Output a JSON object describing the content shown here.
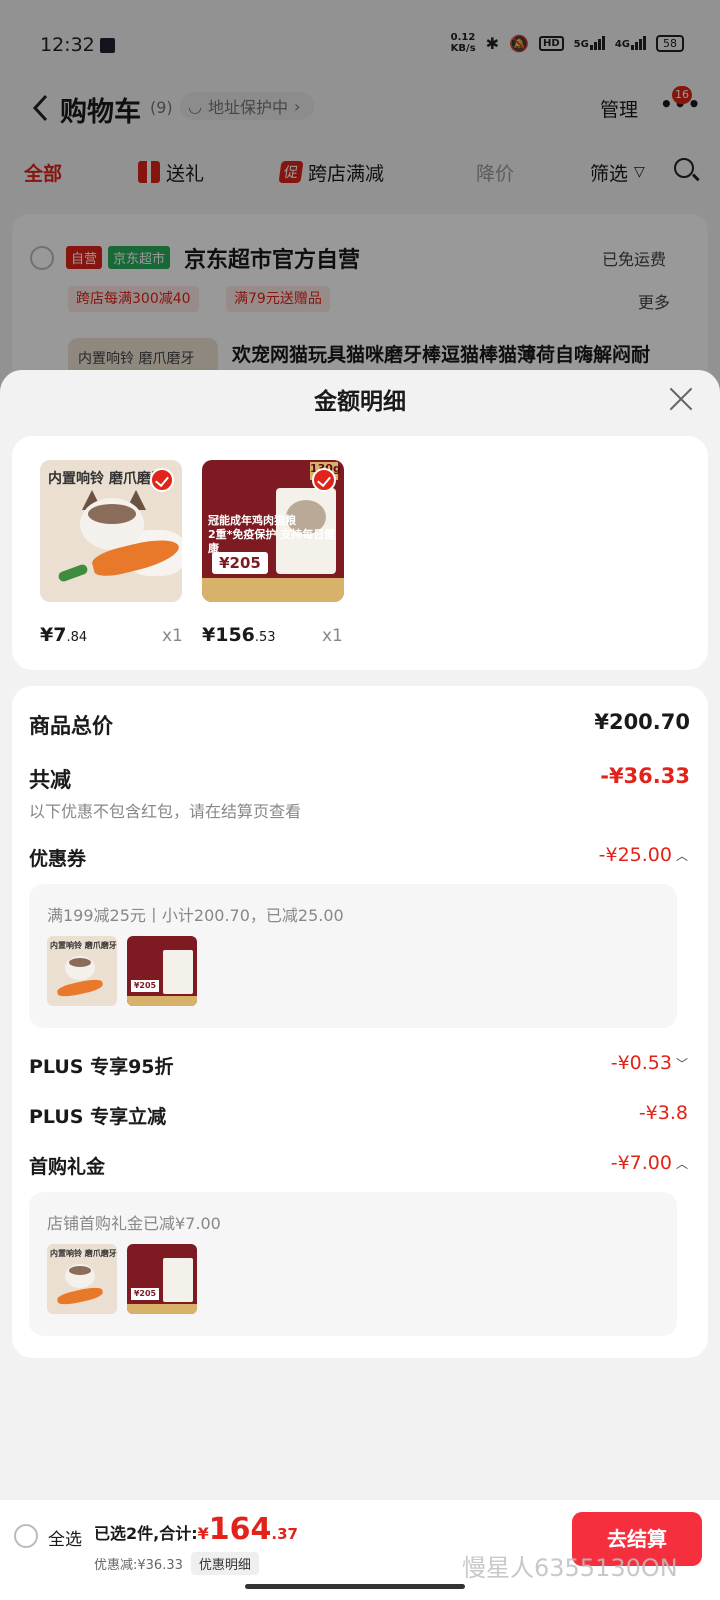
{
  "status_bar": {
    "time": "12:32",
    "net_speed_value": "0.12",
    "net_speed_unit": "KB/s",
    "hd_label": "HD",
    "signal_1": "5G",
    "signal_2": "4G",
    "battery": "58"
  },
  "nav": {
    "title": "购物车",
    "count": "(9)",
    "address_protect": "地址保护中",
    "manage": "管理",
    "more_badge": "16"
  },
  "tabs": {
    "all": "全部",
    "gift": "送礼",
    "cross_store_icon": "促",
    "cross_store": "跨店满减",
    "price_drop": "降价",
    "filter": "筛选"
  },
  "store": {
    "tag_self": "自营",
    "tag_market": "京东超市",
    "name": "京东超市官方自营",
    "free_shipping": "已免运费",
    "promo_1": "跨店每满300减40",
    "promo_2": "满79元送赠品",
    "more": "更多",
    "product_image_text": "内置响铃 磨爪磨牙",
    "product_title": "欢宠网猫玩具猫咪磨牙棒逗猫棒猫薄荷自嗨解闷耐"
  },
  "sheet": {
    "title": "金额明细",
    "items": [
      {
        "image_text": "内置响铃 磨爪磨牙",
        "price_int": "¥7",
        "price_dec": ".84",
        "qty": "x1"
      },
      {
        "image_badge": "130g",
        "image_text": "冠能成年鸡肉猫粮",
        "image_headline": "2重*免疫保护 支持每日健康",
        "image_price": "¥205",
        "price_int": "¥156",
        "price_dec": ".53",
        "qty": "x1"
      }
    ],
    "total_label": "商品总价",
    "total_value": "¥200.70",
    "reduction_label": "共减",
    "reduction_value": "-¥36.33",
    "reduction_hint": "以下优惠不包含红包，请在结算页查看",
    "coupon_label": "优惠券",
    "coupon_value": "-¥25.00",
    "coupon_detail": "满199减25元丨小计200.70，已减25.00",
    "plus95_label": "PLUS 专享95折",
    "plus95_value": "-¥0.53",
    "plus_instant_label": "PLUS 专享立减",
    "plus_instant_value": "-¥3.8",
    "first_gift_label": "首购礼金",
    "first_gift_value": "-¥7.00",
    "first_gift_detail": "店铺首购礼金已减¥7.00"
  },
  "checkout": {
    "select_all": "全选",
    "summary_prefix": "已选2件,合计:",
    "total_currency": "¥",
    "total_int": "164",
    "total_dec": ".37",
    "discount_text": "优惠减:¥36.33",
    "detail_chip": "优惠明细",
    "button": "去结算",
    "watermark": "慢星人6355130ON"
  },
  "colors": {
    "accent_red": "#e2231a",
    "checkout_red": "#f52f3e",
    "market_green": "#2bad5c"
  }
}
